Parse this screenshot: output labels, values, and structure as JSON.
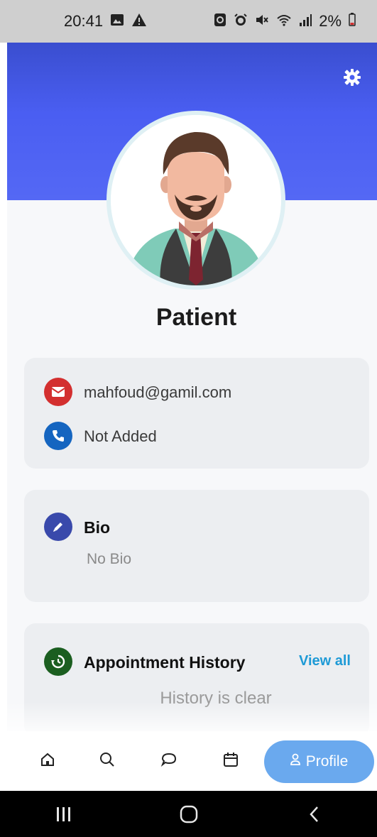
{
  "status_bar": {
    "time": "20:41",
    "battery": "2%",
    "left_icons": [
      "gallery-icon",
      "warning-icon"
    ],
    "right_icons": [
      "sync-icon",
      "alarm-icon",
      "mute-icon",
      "wifi-icon",
      "signal-icon",
      "battery-icon"
    ]
  },
  "header": {
    "color": "#4a5ef2",
    "settings_icon": "gear-icon"
  },
  "profile": {
    "role": "Patient",
    "avatar": "doctor-avatar"
  },
  "contact": {
    "email": "mahfoud@gamil.com",
    "phone": "Not Added",
    "email_icon": "mail-icon",
    "phone_icon": "phone-icon",
    "email_icon_color": "#d32f2f",
    "phone_icon_color": "#1565c0"
  },
  "bio": {
    "title": "Bio",
    "text": "No Bio",
    "icon": "edit-icon",
    "icon_color": "#3949ab"
  },
  "history": {
    "title": "Appointment History",
    "view_all": "View all",
    "empty": "History is clear",
    "icon": "history-icon",
    "icon_color": "#1b5e20"
  },
  "bottom_nav": {
    "items": [
      "home-icon",
      "search-icon",
      "chat-icon",
      "calendar-icon"
    ],
    "active_label": "Profile",
    "active_color": "#6aa9ee"
  },
  "system_nav": [
    "recents-button",
    "home-button",
    "back-button"
  ]
}
